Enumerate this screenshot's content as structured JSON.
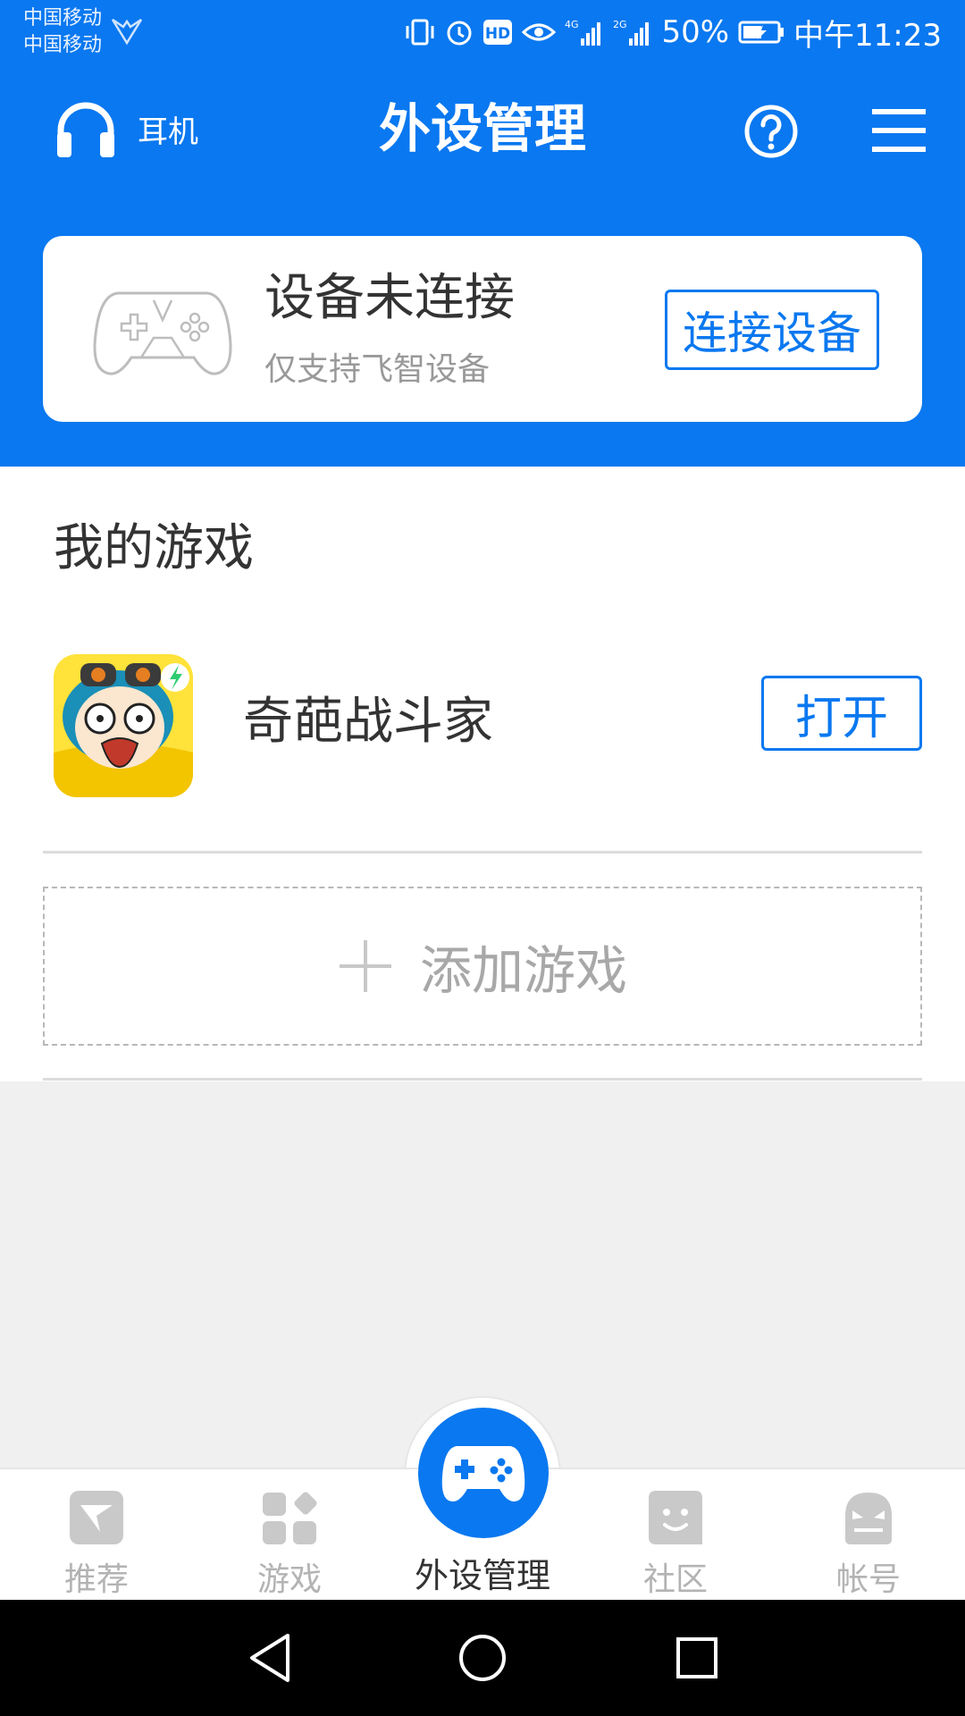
{
  "status_bar": {
    "carrier_1": "中国移动",
    "carrier_2": "中国移动",
    "battery": "50%",
    "time": "中午11:23",
    "icons": [
      "vibrate-icon",
      "alarm-icon",
      "hd-icon",
      "eye-icon",
      "signal-4g-icon",
      "signal-2g-icon",
      "battery-icon"
    ]
  },
  "header": {
    "headphone_label": "耳机",
    "title": "外设管理",
    "help_icon": "help-icon",
    "menu_icon": "menu-icon"
  },
  "device_card": {
    "status": "设备未连接",
    "note": "仅支持飞智设备",
    "connect_button": "连接设备"
  },
  "games": {
    "section_title": "我的游戏",
    "items": [
      {
        "name": "奇葩战斗家",
        "action": "打开"
      }
    ],
    "add_label": "添加游戏"
  },
  "tabbar": {
    "tabs": [
      {
        "label": "推荐",
        "icon": "recommend-icon"
      },
      {
        "label": "游戏",
        "icon": "games-icon"
      },
      {
        "label": "外设管理",
        "icon": "gamepad-icon",
        "active": true
      },
      {
        "label": "社区",
        "icon": "community-icon"
      },
      {
        "label": "帐号",
        "icon": "account-icon"
      }
    ]
  },
  "colors": {
    "primary": "#0a78f0",
    "text_dark": "#333333",
    "text_muted": "#999999",
    "tab_inactive": "#b3b3b3"
  }
}
